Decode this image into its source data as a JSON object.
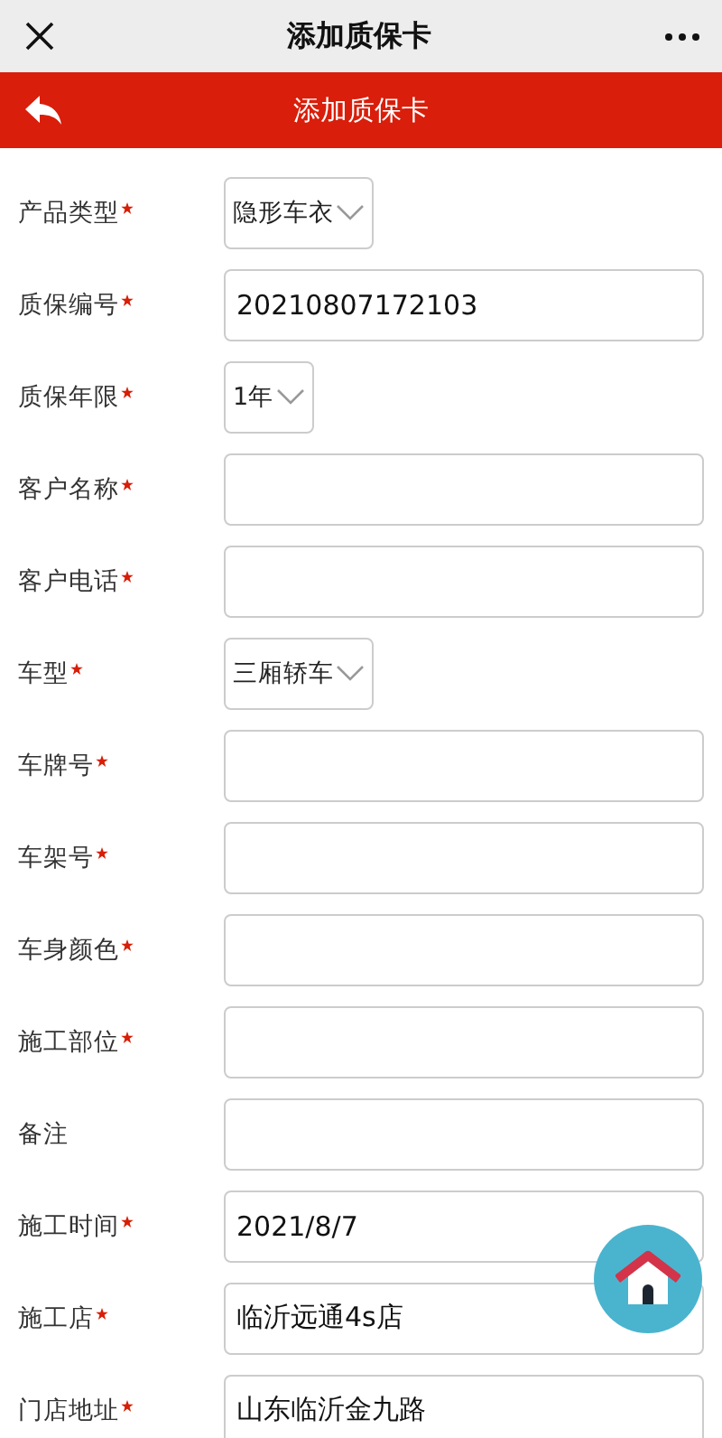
{
  "top_bar": {
    "title": "添加质保卡"
  },
  "header": {
    "title": "添加质保卡"
  },
  "fields": [
    {
      "label": "产品类型",
      "required": true,
      "kind": "select",
      "value": "隐形车衣"
    },
    {
      "label": "质保编号",
      "required": true,
      "kind": "input",
      "value": "20210807172103"
    },
    {
      "label": "质保年限",
      "required": true,
      "kind": "select",
      "value": "1年"
    },
    {
      "label": "客户名称",
      "required": true,
      "kind": "input"
    },
    {
      "label": "客户电话",
      "required": true,
      "kind": "input"
    },
    {
      "label": "车型",
      "required": true,
      "kind": "select",
      "value": "三厢轿车"
    },
    {
      "label": "车牌号",
      "required": true,
      "kind": "input"
    },
    {
      "label": "车架号",
      "required": true,
      "kind": "input"
    },
    {
      "label": "车身颜色",
      "required": true,
      "kind": "input"
    },
    {
      "label": "施工部位",
      "required": true,
      "kind": "input"
    },
    {
      "label": "备注",
      "required": false,
      "kind": "input"
    },
    {
      "label": "施工时间",
      "required": true,
      "kind": "input",
      "value": "2021/8/7"
    },
    {
      "label": "施工店",
      "required": true,
      "kind": "input",
      "value": "临沂远通4s店"
    },
    {
      "label": "门店地址",
      "required": true,
      "kind": "input",
      "value": "山东临沂金九路"
    }
  ]
}
